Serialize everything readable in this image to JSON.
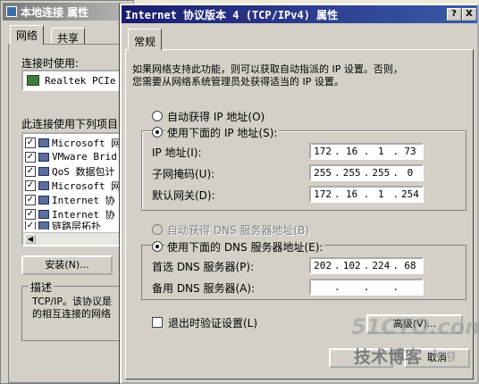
{
  "bg_window": {
    "title": "本地连接 属性",
    "tabs": [
      "网络",
      "共享"
    ],
    "connect_using_label": "连接时使用:",
    "adapter": "Realtek PCIe",
    "items_label": "此连接使用下列项目",
    "items": [
      "Microsoft 网",
      "VMware Brid",
      "QoS 数据包计",
      "Microsoft 网",
      "Internet 协",
      "Internet 协",
      "链路层拓扑"
    ],
    "install_button": "安装(N)...",
    "description_label": "描述",
    "description_text_1": "TCP/IP。该协议是",
    "description_text_2": "的相互连接的网络"
  },
  "fg_window": {
    "title": "Internet 协议版本 4 (TCP/IPv4) 属性",
    "help_btn": "?",
    "close_btn": "X",
    "tab": "常规",
    "intro_1": "如果网络支持此功能，则可以获取自动指派的 IP 设置。否则，",
    "intro_2": "您需要从网络系统管理员处获得适当的 IP 设置。",
    "auto_ip": "自动获得 IP 地址(O)",
    "manual_ip": "使用下面的 IP 地址(S):",
    "ip_label": "IP 地址(I):",
    "ip": [
      "172",
      "16",
      "1",
      "73"
    ],
    "mask_label": "子网掩码(U):",
    "mask": [
      "255",
      "255",
      "255",
      "0"
    ],
    "gw_label": "默认网关(D):",
    "gw": [
      "172",
      "16",
      "1",
      "254"
    ],
    "auto_dns": "自动获得 DNS 服务器地址(B)",
    "manual_dns": "使用下面的 DNS 服务器地址(E):",
    "dns1_label": "首选 DNS 服务器(P):",
    "dns1": [
      "202",
      "102",
      "224",
      "68"
    ],
    "dns2_label": "备用 DNS 服务器(A):",
    "dns2": [
      "",
      "",
      "",
      ""
    ],
    "validate_label": "退出时验证设置(L)",
    "advanced_button": "高级(V)...",
    "cancel_button": "取消"
  },
  "watermark": {
    "site": "51CTO.com",
    "blog": "技术博客",
    "blog_suffix": "log"
  }
}
